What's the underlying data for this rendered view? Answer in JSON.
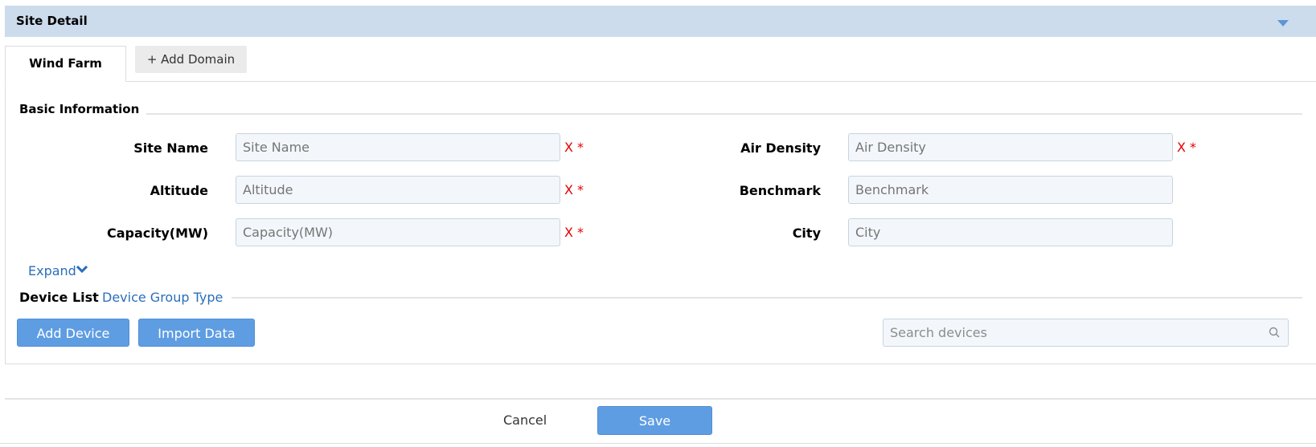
{
  "header": {
    "title": "Site Detail",
    "toggle_icon": "caret-down-icon",
    "accent": "#5c96d5",
    "background": "#ccdcec"
  },
  "tabs": [
    {
      "label": "Wind Farm",
      "active": true
    },
    {
      "label": "+ Add Domain",
      "active": false
    }
  ],
  "basic_info": {
    "title": "Basic Information",
    "fields_left": [
      {
        "label": "Site Name",
        "placeholder": "Site Name",
        "required_mark": "X *"
      },
      {
        "label": "Altitude",
        "placeholder": "Altitude",
        "required_mark": "X *"
      },
      {
        "label": "Capacity(MW)",
        "placeholder": "Capacity(MW)",
        "required_mark": "X *"
      }
    ],
    "fields_right": [
      {
        "label": "Air Density",
        "placeholder": "Air Density",
        "required_mark": "X *"
      },
      {
        "label": "Benchmark",
        "placeholder": "Benchmark"
      },
      {
        "label": "City",
        "placeholder": "City"
      }
    ],
    "expand_label": "Expand",
    "expand_icon": "chevron-down-icon"
  },
  "device_list": {
    "title": "Device List",
    "group_type_link": "Device Group Type",
    "add_device_label": "Add Device",
    "import_data_label": "Import Data",
    "search_placeholder": "Search devices",
    "search_icon": "search-icon"
  },
  "footer": {
    "cancel_label": "Cancel",
    "save_label": "Save"
  },
  "colors": {
    "primary_button": "#5f9de3",
    "required": "#e60000",
    "link": "#2a6ebb"
  }
}
